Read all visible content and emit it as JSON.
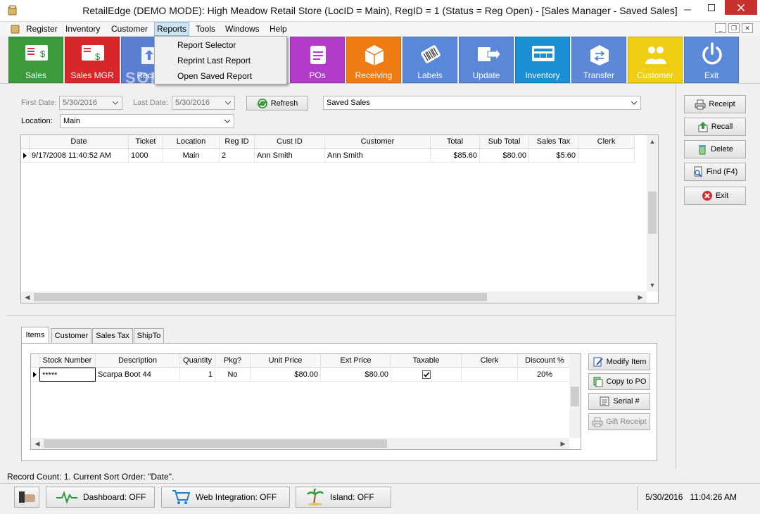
{
  "window": {
    "title": "RetailEdge (DEMO MODE): High Meadow Retail Store (LocID = Main),  RegID = 1 (Status = Reg Open) - [Sales Manager - Saved Sales]"
  },
  "menu": {
    "items": [
      "Register",
      "Inventory",
      "Customer",
      "Reports",
      "Tools",
      "Windows",
      "Help"
    ],
    "reports_dropdown": [
      "Report Selector",
      "Reprint Last Report",
      "Open Saved Report"
    ]
  },
  "toolbar": {
    "tiles": [
      {
        "label": "Sales",
        "color": "#3b9a3b",
        "icon": "sales-icon"
      },
      {
        "label": "Sales MGR",
        "color": "#d9262a",
        "icon": "sales-mgr-icon"
      },
      {
        "label": "Recall",
        "color": "#5a7fd1",
        "icon": "recall-icon"
      },
      {
        "label": "POs",
        "color": "#b33bc9",
        "icon": "pos-icon"
      },
      {
        "label": "Receiving",
        "color": "#ef7b13",
        "icon": "receiving-icon"
      },
      {
        "label": "Labels",
        "color": "#5a88d8",
        "icon": "labels-icon"
      },
      {
        "label": "Update",
        "color": "#5b88d6",
        "icon": "update-icon"
      },
      {
        "label": "Inventory",
        "color": "#1b8fd6",
        "icon": "inventory-icon"
      },
      {
        "label": "Transfer",
        "color": "#5c88d5",
        "icon": "transfer-icon"
      },
      {
        "label": "Customer",
        "color": "#efce14",
        "icon": "customer-icon"
      },
      {
        "label": "Exit",
        "color": "#5a8ad8",
        "icon": "exit-icon"
      }
    ]
  },
  "filters": {
    "first_date_label": "First Date:",
    "first_date_value": "5/30/2016",
    "last_date_label": "Last Date:",
    "last_date_value": "5/30/2016",
    "refresh_label": "Refresh",
    "view_value": "Saved Sales",
    "location_label": "Location:",
    "location_value": "Main"
  },
  "sales_grid": {
    "columns": [
      "Date",
      "Ticket",
      "Location",
      "Reg ID",
      "Cust ID",
      "Customer",
      "Total",
      "Sub Total",
      "Sales Tax",
      "Clerk"
    ],
    "rows": [
      [
        "9/17/2008 11:40:52 AM",
        "1000",
        "Main",
        "2",
        "Ann Smith",
        "Ann Smith",
        "$85.60",
        "$80.00",
        "$5.60",
        ""
      ]
    ]
  },
  "side_buttons": [
    {
      "label": "Receipt",
      "icon": "printer-icon"
    },
    {
      "label": "Recall",
      "icon": "recall-arrow-icon"
    },
    {
      "label": "Delete",
      "icon": "trash-icon"
    },
    {
      "label": "Find (F4)",
      "icon": "find-icon"
    },
    {
      "label": "Exit",
      "icon": "exit-x-icon"
    }
  ],
  "detail_tabs": [
    "Items",
    "Customer",
    "Sales Tax",
    "ShipTo"
  ],
  "items_grid": {
    "columns": [
      "Stock Number",
      "Description",
      "Quantity",
      "Pkg?",
      "Unit Price",
      "Ext Price",
      "Taxable",
      "Clerk",
      "Discount %"
    ],
    "rows": [
      {
        "stock": "*****",
        "description": "Scarpa Boot 44",
        "quantity": "1",
        "pkg": "No",
        "unit_price": "$80.00",
        "ext_price": "$80.00",
        "taxable": true,
        "clerk": "",
        "discount": "20%"
      }
    ]
  },
  "item_buttons": [
    {
      "label": "Modify Item",
      "icon": "modify-icon",
      "enabled": true
    },
    {
      "label": "Copy to PO",
      "icon": "copy-icon",
      "enabled": true
    },
    {
      "label": "Serial #",
      "icon": "serial-icon",
      "enabled": true
    },
    {
      "label": "Gift Receipt",
      "icon": "gift-printer-icon",
      "enabled": false
    }
  ],
  "status": {
    "record_count": "Record Count: 1.  Current Sort Order: \"Date\"."
  },
  "bottom": {
    "dashboard": "Dashboard: OFF",
    "web": "Web Integration: OFF",
    "island": "Island: OFF",
    "date": "5/30/2016",
    "time": "11:04:26 AM"
  },
  "watermark": "SOFTPEDIA"
}
